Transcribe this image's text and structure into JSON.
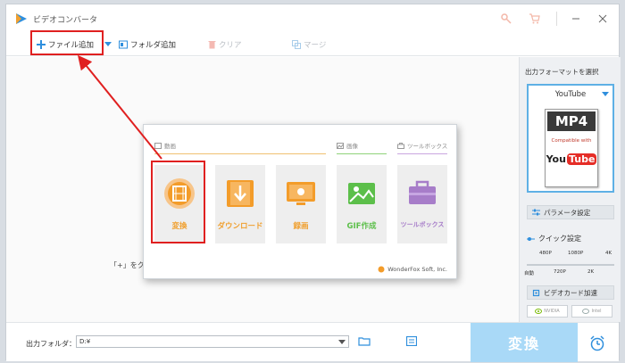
{
  "app": {
    "title": "ビデオコンバータ"
  },
  "toolbar": {
    "add_file": "ファイル追加",
    "add_folder": "フォルダ追加",
    "clear": "クリア",
    "merge": "マージ"
  },
  "main": {
    "hint": "「+」をクリ"
  },
  "popup": {
    "sections": {
      "video": "動画",
      "image": "画像",
      "toolbox": "ツールボックス"
    },
    "tiles": [
      {
        "label": "変換",
        "icon": "film-icon"
      },
      {
        "label": "ダウンロード",
        "icon": "download-icon"
      },
      {
        "label": "録画",
        "icon": "screen-record-icon"
      },
      {
        "label": "GIF作成",
        "icon": "image-icon"
      },
      {
        "label": "ツールボックス",
        "icon": "toolbox-icon"
      }
    ],
    "brand": "WonderFox Soft, Inc."
  },
  "right_panel": {
    "title": "出力フォーマットを選択",
    "format_name": "YouTube",
    "card_format": "MP4",
    "card_compat": "Compatible with",
    "card_you": "You",
    "card_tube": "Tube",
    "params": "パラメータ設定",
    "quick": "クイック設定",
    "quality_top": [
      "480P",
      "1080P",
      "4K"
    ],
    "quality_bottom": [
      "自動",
      "720P",
      "2K"
    ],
    "gpu": "ビデオカード加速",
    "nvidia": "NVIDIA",
    "intel": "Intel"
  },
  "bottom": {
    "output_label": "出力フォルダ：",
    "output_path": "D:¥",
    "convert": "変換"
  },
  "colors": {
    "accent": "#2f8fdd",
    "convert_btn": "#a9d9f7",
    "tile_orange": "#f0a030",
    "tile_green": "#5cbf4a",
    "tile_purple": "#a77dc9",
    "annotation_red": "#e02020"
  }
}
